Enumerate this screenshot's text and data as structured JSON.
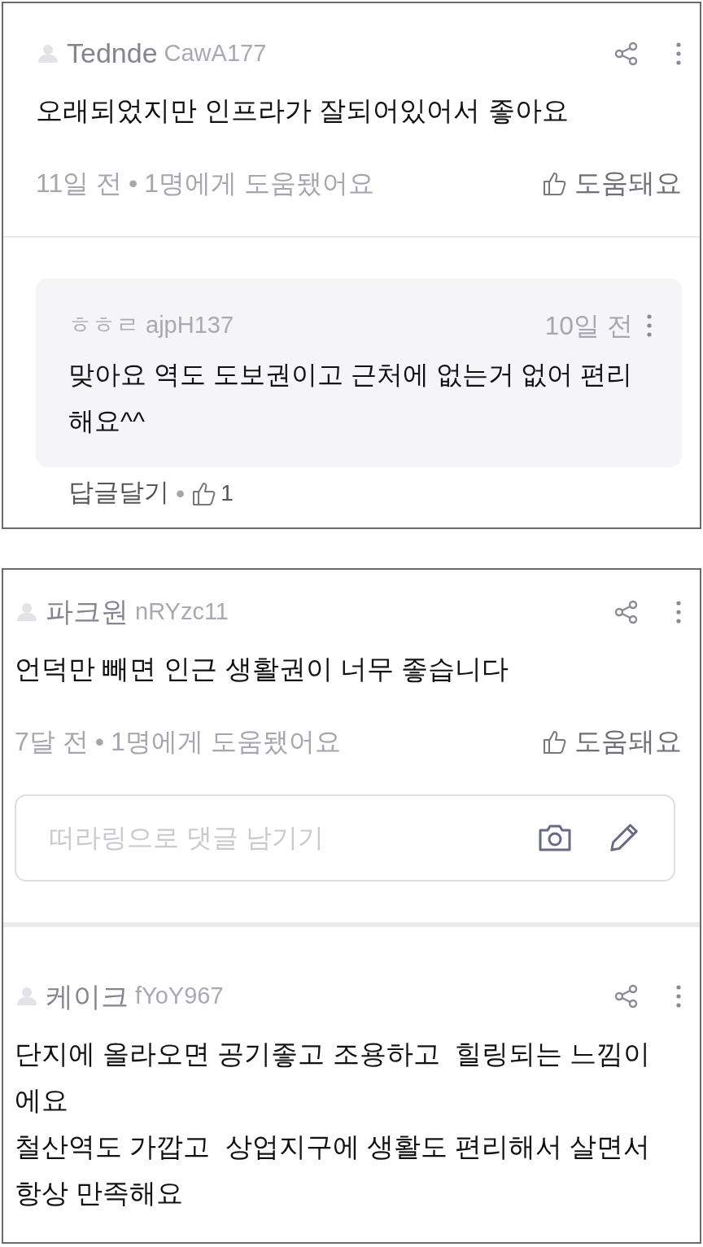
{
  "panels": [
    {
      "items": [
        {
          "kind": "review",
          "name": "Tednde",
          "user_id": "CawA177",
          "text": "오래되었지만 인프라가 잘되어있어서 좋아요",
          "time": "11일 전",
          "separator": "•",
          "helpful_count": "1명에게 도움됐어요",
          "helpful_button": "도움돼요"
        },
        {
          "kind": "reply",
          "name": "ㅎㅎㄹ",
          "user_id": "ajpH137",
          "time": "10일 전",
          "text": "맞아요 역도 도보권이고 근처에 없는거 없어 편리해요^^",
          "reply_link": "답글달기",
          "separator": "•",
          "likes": "1"
        }
      ]
    },
    {
      "items": [
        {
          "kind": "review",
          "name": "파크원",
          "user_id": "nRYzc11",
          "text": "언덕만 빼면 인근 생활권이 너무 좋습니다",
          "time": "7달 전",
          "separator": "•",
          "helpful_count": "1명에게 도움됐어요",
          "helpful_button": "도움돼요"
        },
        {
          "kind": "comment_input",
          "placeholder": "떠라링으로 댓글 남기기"
        },
        {
          "kind": "review",
          "name": "케이크",
          "user_id": "fYoY967",
          "text": "단지에 올라오면 공기좋고 조용하고  힐링되는 느낌이에요\n철산역도 가깝고  상업지구에 생활도 편리해서 살면서 항상 만족해요"
        }
      ]
    }
  ]
}
